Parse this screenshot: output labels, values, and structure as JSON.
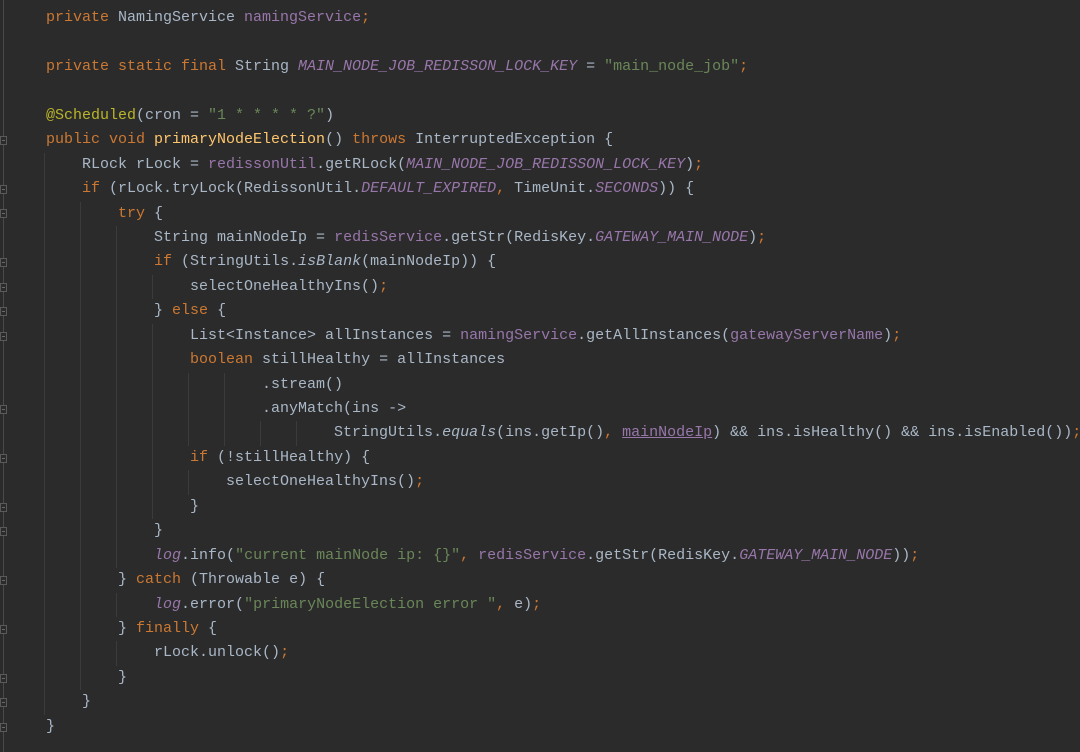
{
  "editor": {
    "theme_colors": {
      "background": "#2b2b2b",
      "keyword": "#cc7832",
      "text": "#a9b7c6",
      "field": "#9876aa",
      "string": "#6a8759",
      "annotation": "#bbb529",
      "method": "#ffc66d"
    },
    "lines": [
      {
        "indent": 0,
        "tokens": [
          [
            "private ",
            "kw"
          ],
          [
            "NamingService ",
            "pl"
          ],
          [
            "namingService",
            "fd"
          ],
          [
            ";",
            "kw"
          ]
        ]
      },
      {
        "indent": 0,
        "tokens": []
      },
      {
        "indent": 0,
        "tokens": [
          [
            "private static final ",
            "kw"
          ],
          [
            "String ",
            "pl"
          ],
          [
            "MAIN_NODE_JOB_REDISSON_LOCK_KEY",
            "sf"
          ],
          [
            " = ",
            "pl"
          ],
          [
            "\"main_node_job\"",
            "st"
          ],
          [
            ";",
            "kw"
          ]
        ]
      },
      {
        "indent": 0,
        "tokens": []
      },
      {
        "indent": 0,
        "tokens": [
          [
            "@Scheduled",
            "an"
          ],
          [
            "(cron = ",
            "pl"
          ],
          [
            "\"1 * * * * ?\"",
            "st"
          ],
          [
            ")",
            "pl"
          ]
        ]
      },
      {
        "indent": 0,
        "tokens": [
          [
            "public void ",
            "kw"
          ],
          [
            "primaryNodeElection",
            "md"
          ],
          [
            "() ",
            "pl"
          ],
          [
            "throws ",
            "kw"
          ],
          [
            "InterruptedException {",
            "pl"
          ]
        ]
      },
      {
        "indent": 1,
        "tokens": [
          [
            "RLock rLock = ",
            "pl"
          ],
          [
            "redissonUtil",
            "fd"
          ],
          [
            ".getRLock(",
            "pl"
          ],
          [
            "MAIN_NODE_JOB_REDISSON_LOCK_KEY",
            "sf"
          ],
          [
            ")",
            "pl"
          ],
          [
            ";",
            "kw"
          ]
        ]
      },
      {
        "indent": 1,
        "tokens": [
          [
            "if ",
            "kw"
          ],
          [
            "(rLock.tryLock(RedissonUtil.",
            "pl"
          ],
          [
            "DEFAULT_EXPIRED",
            "sf"
          ],
          [
            ", ",
            "kw"
          ],
          [
            "TimeUnit.",
            "pl"
          ],
          [
            "SECONDS",
            "sf"
          ],
          [
            ")) {",
            "pl"
          ]
        ]
      },
      {
        "indent": 2,
        "tokens": [
          [
            "try ",
            "kw"
          ],
          [
            "{",
            "pl"
          ]
        ]
      },
      {
        "indent": 3,
        "tokens": [
          [
            "String mainNodeIp = ",
            "pl"
          ],
          [
            "redisService",
            "fd"
          ],
          [
            ".getStr(RedisKey.",
            "pl"
          ],
          [
            "GATEWAY_MAIN_NODE",
            "sf"
          ],
          [
            ")",
            "pl"
          ],
          [
            ";",
            "kw"
          ]
        ]
      },
      {
        "indent": 3,
        "tokens": [
          [
            "if ",
            "kw"
          ],
          [
            "(StringUtils.",
            "pl"
          ],
          [
            "isBlank",
            "it"
          ],
          [
            "(mainNodeIp)) {",
            "pl"
          ]
        ]
      },
      {
        "indent": 4,
        "tokens": [
          [
            "selectOneHealthyIns()",
            "pl"
          ],
          [
            ";",
            "kw"
          ]
        ]
      },
      {
        "indent": 3,
        "tokens": [
          [
            "} ",
            "pl"
          ],
          [
            "else ",
            "kw"
          ],
          [
            "{",
            "pl"
          ]
        ]
      },
      {
        "indent": 4,
        "tokens": [
          [
            "List<Instance> allInstances = ",
            "pl"
          ],
          [
            "namingService",
            "fd"
          ],
          [
            ".getAllInstances(",
            "pl"
          ],
          [
            "gatewayServerName",
            "fd"
          ],
          [
            ")",
            "pl"
          ],
          [
            ";",
            "kw"
          ]
        ]
      },
      {
        "indent": 4,
        "tokens": [
          [
            "boolean ",
            "kw"
          ],
          [
            "stillHealthy = allInstances",
            "pl"
          ]
        ]
      },
      {
        "indent": 6,
        "tokens": [
          [
            ".stream()",
            "pl"
          ]
        ]
      },
      {
        "indent": 6,
        "tokens": [
          [
            ".anyMatch(ins ->",
            "pl"
          ]
        ]
      },
      {
        "indent": 8,
        "tokens": [
          [
            "StringUtils.",
            "pl"
          ],
          [
            "equals",
            "it"
          ],
          [
            "(ins.getIp()",
            "pl"
          ],
          [
            ", ",
            "kw"
          ],
          [
            "mainNodeIp",
            "ul"
          ],
          [
            ") && ins.isHealthy() && ins.isEnabled())",
            "pl"
          ],
          [
            ";",
            "kw"
          ]
        ]
      },
      {
        "indent": 4,
        "tokens": [
          [
            "if ",
            "kw"
          ],
          [
            "(!stillHealthy) {",
            "pl"
          ]
        ]
      },
      {
        "indent": 5,
        "tokens": [
          [
            "selectOneHealthyIns()",
            "pl"
          ],
          [
            ";",
            "kw"
          ]
        ]
      },
      {
        "indent": 4,
        "tokens": [
          [
            "}",
            "pl"
          ]
        ]
      },
      {
        "indent": 3,
        "tokens": [
          [
            "}",
            "pl"
          ]
        ]
      },
      {
        "indent": 3,
        "tokens": [
          [
            "log",
            "sf"
          ],
          [
            ".info(",
            "pl"
          ],
          [
            "\"current mainNode ip: {}\"",
            "st"
          ],
          [
            ", ",
            "kw"
          ],
          [
            "redisService",
            "fd"
          ],
          [
            ".getStr(RedisKey.",
            "pl"
          ],
          [
            "GATEWAY_MAIN_NODE",
            "sf"
          ],
          [
            "))",
            "pl"
          ],
          [
            ";",
            "kw"
          ]
        ]
      },
      {
        "indent": 2,
        "tokens": [
          [
            "} ",
            "pl"
          ],
          [
            "catch ",
            "kw"
          ],
          [
            "(Throwable e) {",
            "pl"
          ]
        ]
      },
      {
        "indent": 3,
        "tokens": [
          [
            "log",
            "sf"
          ],
          [
            ".error(",
            "pl"
          ],
          [
            "\"primaryNodeElection error \"",
            "st"
          ],
          [
            ", ",
            "kw"
          ],
          [
            "e)",
            "pl"
          ],
          [
            ";",
            "kw"
          ]
        ]
      },
      {
        "indent": 2,
        "tokens": [
          [
            "} ",
            "pl"
          ],
          [
            "finally ",
            "kw"
          ],
          [
            "{",
            "pl"
          ]
        ]
      },
      {
        "indent": 3,
        "tokens": [
          [
            "rLock.unlock()",
            "pl"
          ],
          [
            ";",
            "kw"
          ]
        ]
      },
      {
        "indent": 2,
        "tokens": [
          [
            "}",
            "pl"
          ]
        ]
      },
      {
        "indent": 1,
        "tokens": [
          [
            "}",
            "pl"
          ]
        ]
      },
      {
        "indent": 0,
        "tokens": [
          [
            "}",
            "pl"
          ]
        ]
      }
    ],
    "fold_lines": [
      5,
      7,
      8,
      10,
      11,
      12,
      13,
      16,
      18,
      20,
      21,
      23,
      25,
      27,
      28,
      29
    ]
  }
}
